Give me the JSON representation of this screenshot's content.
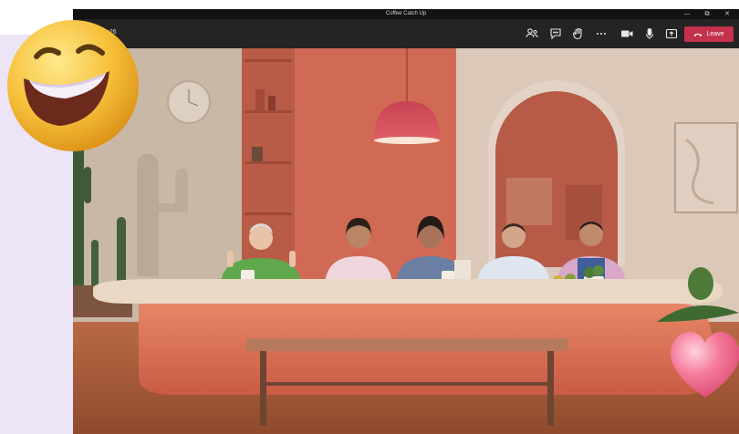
{
  "window": {
    "title": "Coffee Catch Up",
    "controls": {
      "minimize": "—",
      "maximize": "⧉",
      "close": "✕"
    }
  },
  "toolbar": {
    "timer": "0:26",
    "leave_label": "Leave",
    "icons": [
      "participants-icon",
      "chat-icon",
      "raise-hand-icon",
      "more-icon",
      "camera-icon",
      "microphone-icon",
      "share-icon"
    ]
  },
  "scene": {
    "name": "Together mode coffee shop",
    "participants": 5
  },
  "colors": {
    "leave": "#c4314b",
    "wall_left": "#c9b8a5",
    "wall_center": "#d16a55",
    "counter": "#e47a5e",
    "lamp": "#d94f5c"
  }
}
